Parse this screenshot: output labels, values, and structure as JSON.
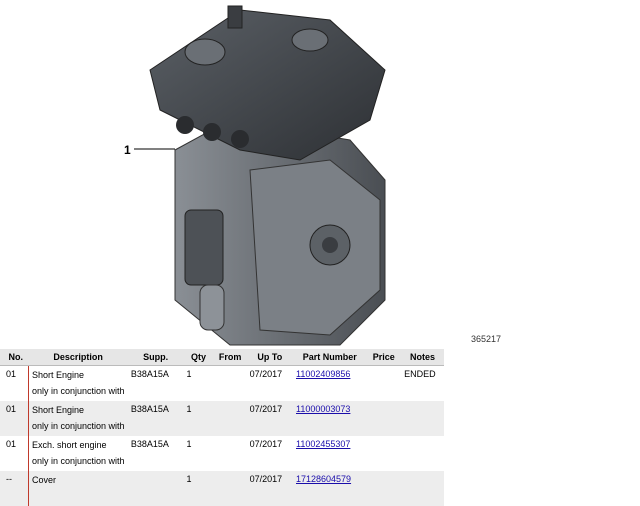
{
  "figure": {
    "callout_label": "1",
    "diagram_id": "365217"
  },
  "table": {
    "headers": [
      "No.",
      "Description",
      "Supp.",
      "Qty",
      "From",
      "Up To",
      "Part Number",
      "Price",
      "Notes"
    ],
    "rows": [
      {
        "no": "01",
        "desc1": "Short Engine",
        "desc2": "only in conjunction with",
        "supp": "B38A15A",
        "qty": "1",
        "from": "",
        "upto": "07/2017",
        "part": "11002409856",
        "price": "",
        "notes": "ENDED"
      },
      {
        "no": "01",
        "desc1": "Short Engine",
        "desc2": "only in conjunction with",
        "supp": "B38A15A",
        "qty": "1",
        "from": "",
        "upto": "07/2017",
        "part": "11000003073",
        "price": "",
        "notes": ""
      },
      {
        "no": "01",
        "desc1": "Exch. short engine",
        "desc2": "only in conjunction with",
        "supp": "B38A15A",
        "qty": "1",
        "from": "",
        "upto": "07/2017",
        "part": "11002455307",
        "price": "",
        "notes": ""
      },
      {
        "no": "--",
        "desc1": "Cover",
        "desc2": "",
        "supp": "",
        "qty": "1",
        "from": "",
        "upto": "07/2017",
        "part": "17128604579",
        "price": "",
        "notes": ""
      }
    ]
  },
  "colors": {
    "link": "#1a0dab",
    "accent_line": "#c0392b",
    "header_bg": "#e6e6e6"
  }
}
